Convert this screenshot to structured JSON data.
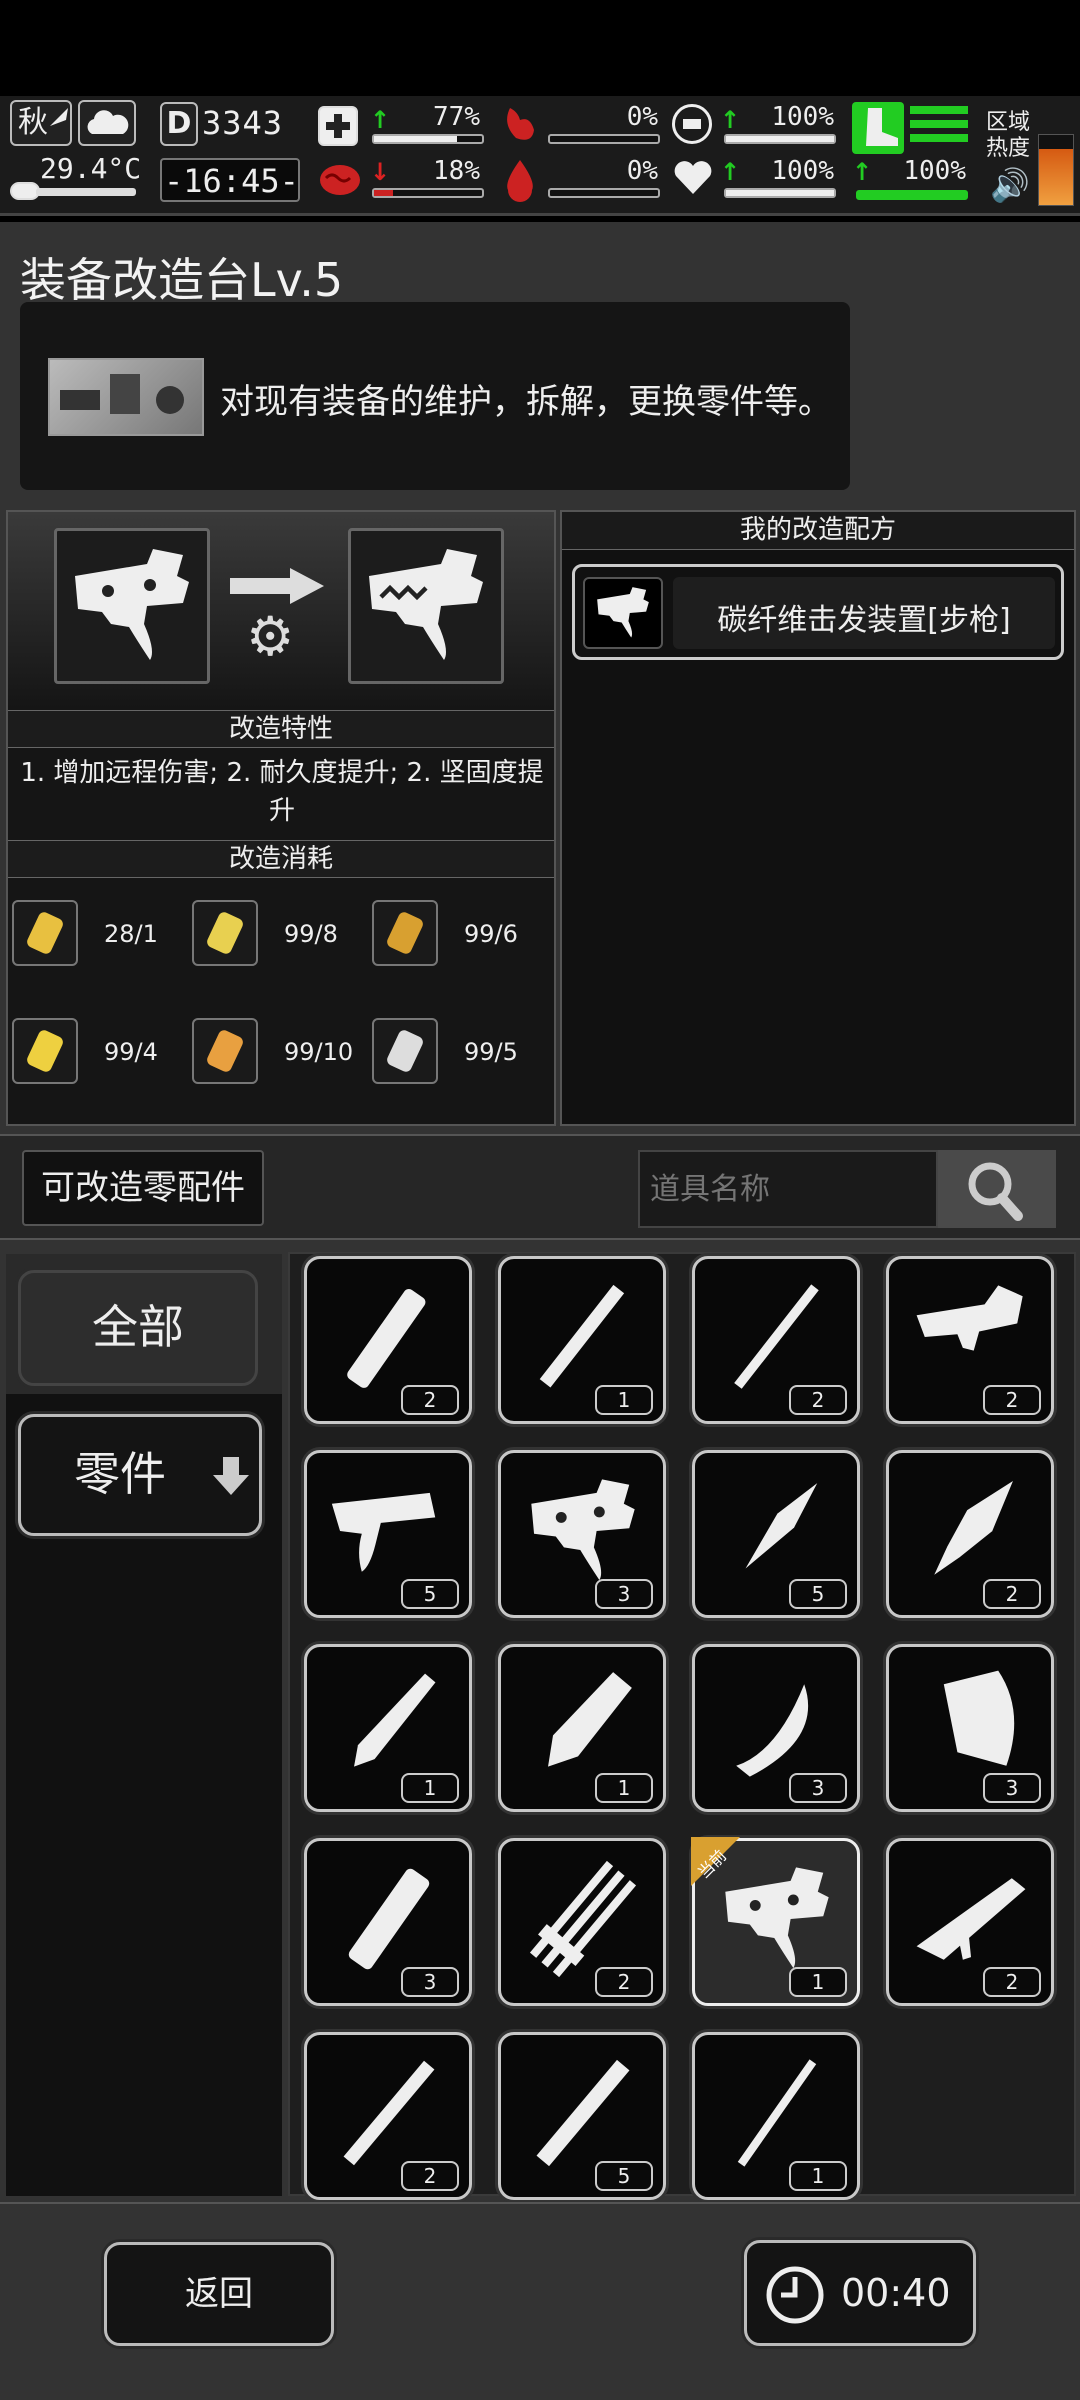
{
  "status_bar": {
    "season": "秋",
    "temperature": "29.4°C",
    "day": "3343",
    "clock": "-16:45-",
    "zone_heat_label_1": "区域",
    "zone_heat_label_2": "热度",
    "stats": [
      {
        "name": "health",
        "value": "77%",
        "level": 0.77
      },
      {
        "name": "hunger",
        "value": "0%",
        "level": 0.0
      },
      {
        "name": "stamina",
        "value": "100%",
        "level": 1.0
      },
      {
        "name": "sanity",
        "value": "18%",
        "level": 0.18
      },
      {
        "name": "bleeding",
        "value": "0%",
        "level": 0.0
      },
      {
        "name": "heart",
        "value": "100%",
        "level": 1.0
      },
      {
        "name": "speed",
        "value": "100%",
        "level": 1.0
      }
    ]
  },
  "station": {
    "title": "装备改造台Lv.5",
    "description": "对现有装备的维护，拆解，更换零件等。"
  },
  "modify": {
    "traits_header": "改造特性",
    "traits_text": "1. 增加远程伤害; 2. 耐久度提升; 2. 坚固度提升",
    "cost_header": "改造消耗",
    "costs": [
      {
        "icon": "chain-links-icon",
        "value": "28/1"
      },
      {
        "icon": "yellow-card-icon",
        "value": "99/8"
      },
      {
        "icon": "gold-coil-icon",
        "value": "99/6"
      },
      {
        "icon": "flask-icon",
        "value": "99/4"
      },
      {
        "icon": "potion-bottle-icon",
        "value": "99/10"
      },
      {
        "icon": "syringe-tool-icon",
        "value": "99/5"
      }
    ]
  },
  "recipes": {
    "header": "我的改造配方",
    "items": [
      {
        "label": "碳纤维击发装置[步枪]"
      }
    ]
  },
  "parts": {
    "tab_label": "可改造零配件",
    "search_placeholder": "道具名称",
    "category_all": "全部",
    "category_parts": "零件",
    "current_label": "当前",
    "items": [
      {
        "icon": "tube-icon",
        "count": "2"
      },
      {
        "icon": "barrel-icon",
        "count": "1"
      },
      {
        "icon": "rod-icon",
        "count": "2"
      },
      {
        "icon": "trigger-group-icon",
        "count": "2"
      },
      {
        "icon": "trigger-assembly-icon",
        "count": "5"
      },
      {
        "icon": "trigger-mechanism-icon",
        "count": "3"
      },
      {
        "icon": "spear-tip-icon",
        "count": "5"
      },
      {
        "icon": "ornate-spear-tip-icon",
        "count": "2"
      },
      {
        "icon": "sword-blade-icon",
        "count": "1"
      },
      {
        "icon": "broad-blade-icon",
        "count": "1"
      },
      {
        "icon": "curved-blade-icon",
        "count": "3"
      },
      {
        "icon": "axe-head-icon",
        "count": "3"
      },
      {
        "icon": "battery-tube-icon",
        "count": "3"
      },
      {
        "icon": "minigun-barrel-icon",
        "count": "2"
      },
      {
        "icon": "trigger-mechanism-icon",
        "count": "1",
        "current": true
      },
      {
        "icon": "rifle-receiver-icon",
        "count": "2"
      },
      {
        "icon": "long-barrel-icon",
        "count": "2"
      },
      {
        "icon": "silencer-barrel-icon",
        "count": "5"
      },
      {
        "icon": "thin-rod-icon",
        "count": "1"
      }
    ]
  },
  "footer": {
    "back_label": "返回",
    "timer": "00:40"
  }
}
